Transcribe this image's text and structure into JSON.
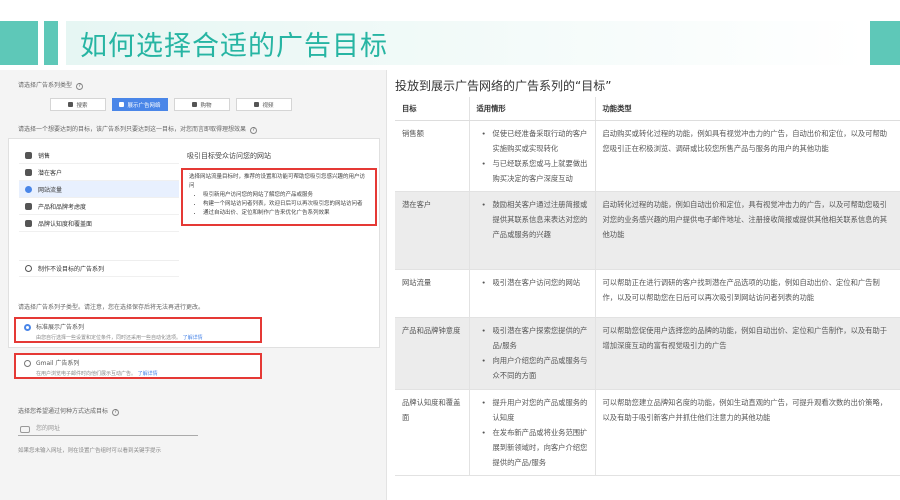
{
  "slide": {
    "title": "如何选择合适的广告目标",
    "accent_color": "#5ec8b8",
    "title_color": "#27b5a3"
  },
  "left_panel": {
    "campaign_type_label": "请选择广告系列类型",
    "tabs": [
      {
        "label": "搜索",
        "icon": "search-icon",
        "active": false
      },
      {
        "label": "展示广告网络",
        "icon": "display-icon",
        "active": true
      },
      {
        "label": "购物",
        "icon": "shopping-icon",
        "active": false
      },
      {
        "label": "视频",
        "icon": "video-icon",
        "active": false
      }
    ],
    "goal_prompt": "请选择一个想要达到的目标，该广告系列只要达到这一目标，对您而言即取得理想效果",
    "goals": [
      {
        "label": "销售",
        "icon": "tag-icon",
        "selected": false
      },
      {
        "label": "潜在客户",
        "icon": "contact-icon",
        "selected": false
      },
      {
        "label": "网站流量",
        "icon": "check-circle-icon",
        "selected": true
      },
      {
        "label": "产品和品牌考虑度",
        "icon": "sparkle-icon",
        "selected": false
      },
      {
        "label": "品牌认知度和覆盖面",
        "icon": "megaphone-icon",
        "selected": false
      }
    ],
    "no_goal_label": "制作不设目标的广告系列",
    "goal_detail_title": "吸引目标受众访问您的网站",
    "goal_detail_intro": "选择网站流量目标时，推荐的设置和功能可帮助您吸引您感兴趣的用户访问",
    "goal_detail_points": [
      "吸引新用户访问您的网站了解您的产品或服务",
      "构建一个网站访问者列表，欢迎日后可以再次吸引您的网站访问者",
      "通过自动出价、定位和制作广告来优化广告系列效果"
    ],
    "subtype_label": "请选择广告系列子类型。请注意，您在选择保存后将无法再进行更改。",
    "subtype_options": [
      {
        "label": "标准展示广告系列",
        "desc": "由您自行选择一些设置和定位条件，同时还采用一些自动化选项。",
        "link": "了解详情",
        "selected": true
      },
      {
        "label": "Gmail 广告系列",
        "desc": "在用户浏览电子邮件时向他们展示互动广告。",
        "link": "了解详情",
        "selected": false
      }
    ],
    "reach_label": "选择您希望通过何种方式达成目标",
    "url_placeholder": "您的网址",
    "footnote": "如果您未输入网址，则在设置广告组时可以看到关键字提示"
  },
  "table": {
    "title": "投放到展示广告网络的广告系列的“目标”",
    "headers": [
      "目标",
      "适用情形",
      "功能类型"
    ],
    "rows": [
      {
        "goal": "销售额",
        "cases": [
          "促使已经准备采取行动的客户实施购买或实现转化",
          "与已经联系您或马上就要做出购买决定的客户深度互动"
        ],
        "features": "启动购买或转化过程的功能，例如具有视觉冲击力的广告，自动出价和定位，以及可帮助您吸引正在积极浏览、调研或比较您所售产品与服务的用户的其他功能",
        "shaded": false
      },
      {
        "goal": "潜在客户",
        "cases": [
          "鼓励相关客户通过注册简报或提供其联系信息来表达对您的产品或服务的兴趣"
        ],
        "features": "启动转化过程的功能，例如自动出价和定位，具有视觉冲击力的广告，以及可帮助您吸引对您的业务感兴趣的用户提供电子邮件地址、注册接收简报或提供其他相关联系信息的其他功能",
        "shaded": true
      },
      {
        "goal": "网站流量",
        "cases": [
          "吸引潜在客户访问您的网站"
        ],
        "features": "可以帮助正在进行调研的客户找到潜在产品选项的功能，例如自动出价、定位和广告制作，以及可以帮助您在日后可以再次吸引到网站访问者列表的功能",
        "shaded": false
      },
      {
        "goal": "产品和品牌钟意度",
        "cases": [
          "吸引潜在客户探索您提供的产品/服务",
          "向用户介绍您的产品或服务与众不同的方面"
        ],
        "features": "可以帮助您促使用户选择您的品牌的功能，例如自动出价、定位和广告制作，以及有助于增加深度互动的富有视觉吸引力的广告",
        "shaded": true
      },
      {
        "goal": "品牌认知度和覆盖面",
        "cases": [
          "提升用户对您的产品或服务的认知度",
          "在发布新产品或将业务范围扩展到新领域时，向客户介绍您提供的产品/服务"
        ],
        "features": "可以帮助您建立品牌知名度的功能，例如生动直观的广告，可提升观看次数的出价策略，以及有助于吸引新客户并抓住他们注意力的其他功能",
        "shaded": false
      }
    ]
  }
}
